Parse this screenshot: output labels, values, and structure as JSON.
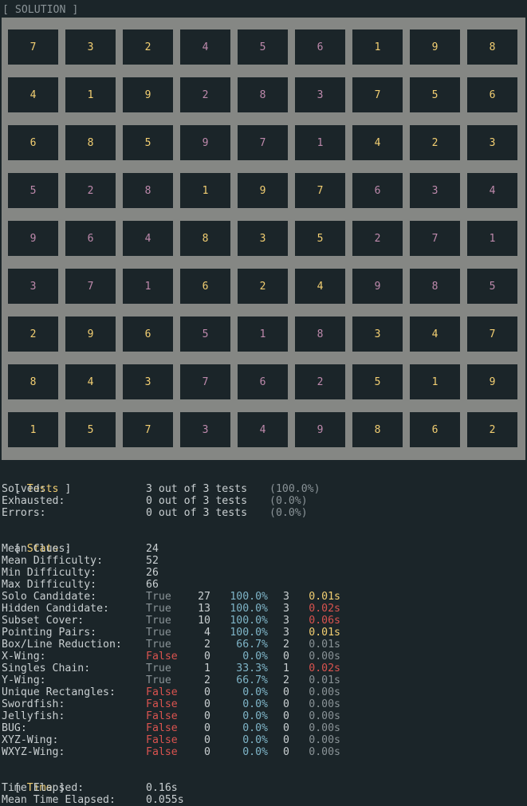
{
  "solution_title": "[ SOLUTION ]",
  "grid": [
    [
      {
        "v": "7",
        "c": "y"
      },
      {
        "v": "3",
        "c": "y"
      },
      {
        "v": "2",
        "c": "y"
      },
      {
        "v": "4",
        "c": "p"
      },
      {
        "v": "5",
        "c": "p"
      },
      {
        "v": "6",
        "c": "p"
      },
      {
        "v": "1",
        "c": "y"
      },
      {
        "v": "9",
        "c": "y"
      },
      {
        "v": "8",
        "c": "y"
      }
    ],
    [
      {
        "v": "4",
        "c": "y"
      },
      {
        "v": "1",
        "c": "y"
      },
      {
        "v": "9",
        "c": "y"
      },
      {
        "v": "2",
        "c": "p"
      },
      {
        "v": "8",
        "c": "p"
      },
      {
        "v": "3",
        "c": "p"
      },
      {
        "v": "7",
        "c": "y"
      },
      {
        "v": "5",
        "c": "y"
      },
      {
        "v": "6",
        "c": "y"
      }
    ],
    [
      {
        "v": "6",
        "c": "y"
      },
      {
        "v": "8",
        "c": "y"
      },
      {
        "v": "5",
        "c": "y"
      },
      {
        "v": "9",
        "c": "p"
      },
      {
        "v": "7",
        "c": "p"
      },
      {
        "v": "1",
        "c": "p"
      },
      {
        "v": "4",
        "c": "y"
      },
      {
        "v": "2",
        "c": "y"
      },
      {
        "v": "3",
        "c": "y"
      }
    ],
    [
      {
        "v": "5",
        "c": "p"
      },
      {
        "v": "2",
        "c": "p"
      },
      {
        "v": "8",
        "c": "p"
      },
      {
        "v": "1",
        "c": "y"
      },
      {
        "v": "9",
        "c": "y"
      },
      {
        "v": "7",
        "c": "y"
      },
      {
        "v": "6",
        "c": "p"
      },
      {
        "v": "3",
        "c": "p"
      },
      {
        "v": "4",
        "c": "p"
      }
    ],
    [
      {
        "v": "9",
        "c": "p"
      },
      {
        "v": "6",
        "c": "p"
      },
      {
        "v": "4",
        "c": "p"
      },
      {
        "v": "8",
        "c": "y"
      },
      {
        "v": "3",
        "c": "y"
      },
      {
        "v": "5",
        "c": "y"
      },
      {
        "v": "2",
        "c": "p"
      },
      {
        "v": "7",
        "c": "p"
      },
      {
        "v": "1",
        "c": "p"
      }
    ],
    [
      {
        "v": "3",
        "c": "p"
      },
      {
        "v": "7",
        "c": "p"
      },
      {
        "v": "1",
        "c": "p"
      },
      {
        "v": "6",
        "c": "y"
      },
      {
        "v": "2",
        "c": "y"
      },
      {
        "v": "4",
        "c": "y"
      },
      {
        "v": "9",
        "c": "p"
      },
      {
        "v": "8",
        "c": "p"
      },
      {
        "v": "5",
        "c": "p"
      }
    ],
    [
      {
        "v": "2",
        "c": "y"
      },
      {
        "v": "9",
        "c": "y"
      },
      {
        "v": "6",
        "c": "y"
      },
      {
        "v": "5",
        "c": "p"
      },
      {
        "v": "1",
        "c": "p"
      },
      {
        "v": "8",
        "c": "p"
      },
      {
        "v": "3",
        "c": "y"
      },
      {
        "v": "4",
        "c": "y"
      },
      {
        "v": "7",
        "c": "y"
      }
    ],
    [
      {
        "v": "8",
        "c": "y"
      },
      {
        "v": "4",
        "c": "y"
      },
      {
        "v": "3",
        "c": "y"
      },
      {
        "v": "7",
        "c": "p"
      },
      {
        "v": "6",
        "c": "p"
      },
      {
        "v": "2",
        "c": "p"
      },
      {
        "v": "5",
        "c": "y"
      },
      {
        "v": "1",
        "c": "y"
      },
      {
        "v": "9",
        "c": "y"
      }
    ],
    [
      {
        "v": "1",
        "c": "y"
      },
      {
        "v": "5",
        "c": "y"
      },
      {
        "v": "7",
        "c": "y"
      },
      {
        "v": "3",
        "c": "p"
      },
      {
        "v": "4",
        "c": "p"
      },
      {
        "v": "9",
        "c": "p"
      },
      {
        "v": "8",
        "c": "y"
      },
      {
        "v": "6",
        "c": "y"
      },
      {
        "v": "2",
        "c": "y"
      }
    ]
  ],
  "colors": {
    "y": "#f3cf72",
    "p": "#bf8aad",
    "board": "#858784",
    "bg": "#1b2529"
  },
  "tests": {
    "open": "[ ",
    "name": "Tests",
    "close": " ]",
    "rows": [
      {
        "label": "Solved:",
        "value": "3 out of 3 tests",
        "pct": "(100.0%)"
      },
      {
        "label": "Exhausted:",
        "value": "0 out of 3 tests",
        "pct": "(0.0%)"
      },
      {
        "label": "Errors:",
        "value": "0 out of 3 tests",
        "pct": "(0.0%)"
      }
    ]
  },
  "stats": {
    "open": "[ ",
    "name": "Stats",
    "close": " ]",
    "summary": [
      {
        "label": "Mean Clues:",
        "value": "24"
      },
      {
        "label": "Mean Difficulty:",
        "value": "52"
      },
      {
        "label": "Min Difficulty:",
        "value": "26"
      },
      {
        "label": "Max Difficulty:",
        "value": "66"
      }
    ],
    "techniques": [
      {
        "label": "Solo Candidate:",
        "used": "True",
        "count": "27",
        "pct": "100.0%",
        "n": "3",
        "time": "0.01s",
        "tc": "y"
      },
      {
        "label": "Hidden Candidate:",
        "used": "True",
        "count": "13",
        "pct": "100.0%",
        "n": "3",
        "time": "0.02s",
        "tc": "r"
      },
      {
        "label": "Subset Cover:",
        "used": "True",
        "count": "10",
        "pct": "100.0%",
        "n": "3",
        "time": "0.06s",
        "tc": "r"
      },
      {
        "label": "Pointing Pairs:",
        "used": "True",
        "count": "4",
        "pct": "100.0%",
        "n": "3",
        "time": "0.01s",
        "tc": "y"
      },
      {
        "label": "Box/Line Reduction:",
        "used": "True",
        "count": "2",
        "pct": "66.7%",
        "n": "2",
        "time": "0.01s",
        "tc": "d"
      },
      {
        "label": "X-Wing:",
        "used": "False",
        "count": "0",
        "pct": "0.0%",
        "n": "0",
        "time": "0.00s",
        "tc": "d"
      },
      {
        "label": "Singles Chain:",
        "used": "True",
        "count": "1",
        "pct": "33.3%",
        "n": "1",
        "time": "0.02s",
        "tc": "r"
      },
      {
        "label": "Y-Wing:",
        "used": "True",
        "count": "2",
        "pct": "66.7%",
        "n": "2",
        "time": "0.01s",
        "tc": "d"
      },
      {
        "label": "Unique Rectangles:",
        "used": "False",
        "count": "0",
        "pct": "0.0%",
        "n": "0",
        "time": "0.00s",
        "tc": "d"
      },
      {
        "label": "Swordfish:",
        "used": "False",
        "count": "0",
        "pct": "0.0%",
        "n": "0",
        "time": "0.00s",
        "tc": "d"
      },
      {
        "label": "Jellyfish:",
        "used": "False",
        "count": "0",
        "pct": "0.0%",
        "n": "0",
        "time": "0.00s",
        "tc": "d"
      },
      {
        "label": "BUG:",
        "used": "False",
        "count": "0",
        "pct": "0.0%",
        "n": "0",
        "time": "0.00s",
        "tc": "d"
      },
      {
        "label": "XYZ-Wing:",
        "used": "False",
        "count": "0",
        "pct": "0.0%",
        "n": "0",
        "time": "0.00s",
        "tc": "d"
      },
      {
        "label": "WXYZ-Wing:",
        "used": "False",
        "count": "0",
        "pct": "0.0%",
        "n": "0",
        "time": "0.00s",
        "tc": "d"
      }
    ]
  },
  "time": {
    "open": "[ ",
    "name": "Time",
    "close": " ]",
    "rows": [
      {
        "label": "Time Elapsed:",
        "value": "0.16s"
      },
      {
        "label": "Mean Time Elapsed:",
        "value": "0.055s"
      }
    ]
  }
}
